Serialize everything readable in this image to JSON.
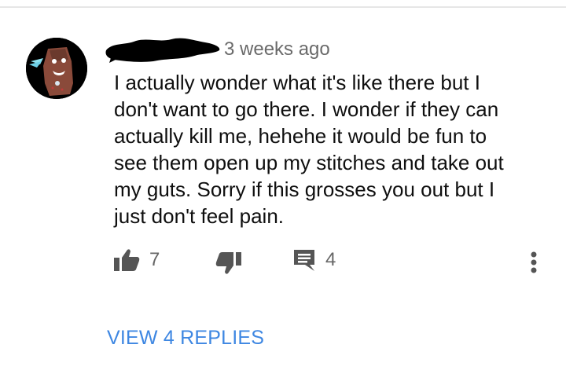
{
  "comment": {
    "timestamp": "3 weeks ago",
    "text": "I actually wonder what it's like there but I\ndon't want to go there. I wonder if they can\nactually kill me, hehehe it would be fun to\nsee them open up my stitches and take out\nmy guts. Sorry if this grosses you out but I\njust don't feel pain.",
    "likes": "7",
    "replies_count": "4"
  },
  "icons": {
    "like": "thumbs-up-icon",
    "dislike": "thumbs-down-icon",
    "reply": "comment-icon",
    "more": "more-vert-icon"
  },
  "view_replies_label": "VIEW 4 REPLIES",
  "colors": {
    "link": "#3e87e2",
    "icon": "#555555",
    "secondary_text": "#6a6a6a"
  }
}
